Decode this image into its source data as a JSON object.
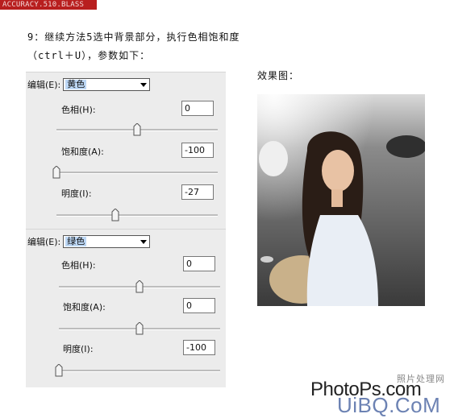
{
  "watermark": "ACCURACY.510.BLASS",
  "instructions": {
    "line1": "9：继续方法5选中背景部分，执行色相饱和度",
    "line2": "（ctrl＋U），参数如下："
  },
  "panels": [
    {
      "edit_label": "编辑(E):",
      "edit_value": "黄色",
      "hue_label": "色相(H):",
      "hue_value": "0",
      "sat_label": "饱和度(A):",
      "sat_value": "-100",
      "light_label": "明度(I):",
      "light_value": "-27",
      "hue_level": 0.5,
      "sat_level": 0.0,
      "light_level": 0.365
    },
    {
      "edit_label": "编辑(E):",
      "edit_value": "绿色",
      "hue_label": "色相(H):",
      "hue_value": "0",
      "sat_label": "饱和度(A):",
      "sat_value": "0",
      "light_label": "明度(I):",
      "light_value": "-100",
      "hue_level": 0.5,
      "sat_level": 0.5,
      "light_level": 0.0
    }
  ],
  "effect_label": "效果图：",
  "logo": {
    "cn": "照片处理网",
    "main": "PhotoPs.com",
    "sub": "UiBQ.CoM"
  }
}
